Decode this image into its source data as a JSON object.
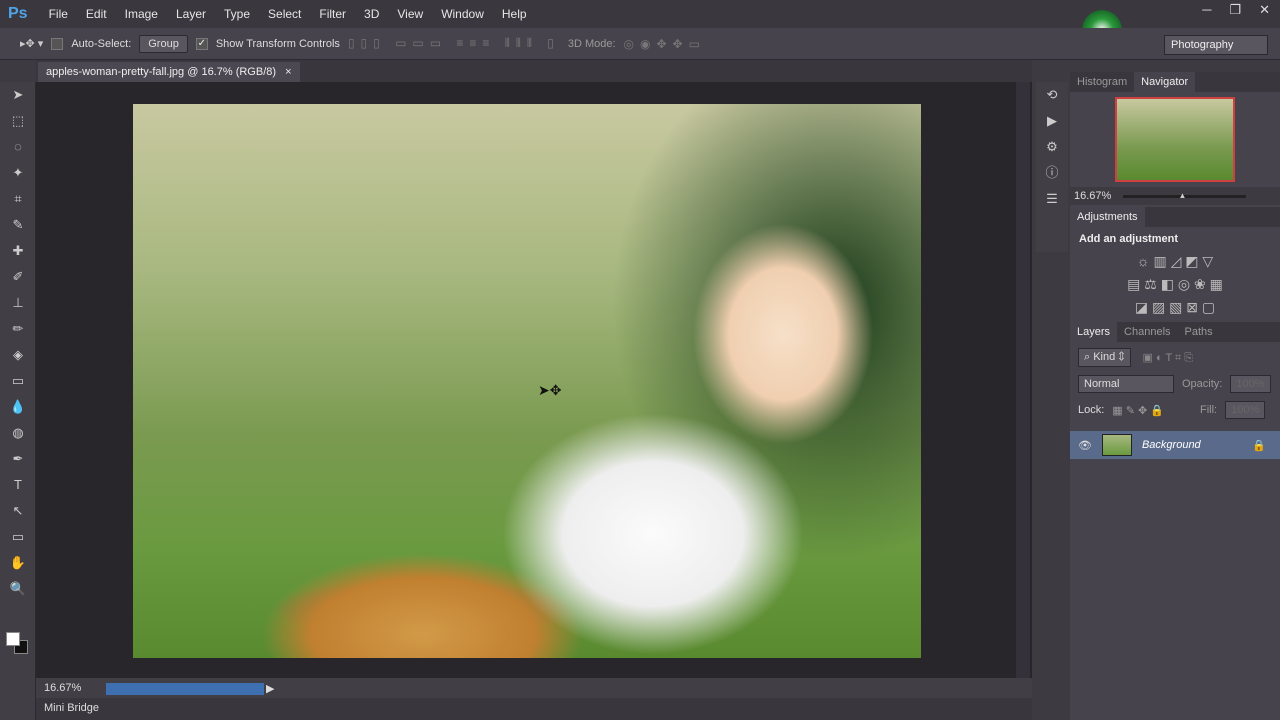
{
  "app": {
    "logo": "Ps"
  },
  "menu": [
    "File",
    "Edit",
    "Image",
    "Layer",
    "Type",
    "Select",
    "Filter",
    "3D",
    "View",
    "Window",
    "Help"
  ],
  "window_controls": [
    "─",
    "❐",
    "✕"
  ],
  "options": {
    "auto_select": "Auto-Select:",
    "group": "Group",
    "show_transform": "Show Transform Controls",
    "mode_3d": "3D Mode:",
    "workspace": "Photography"
  },
  "document": {
    "tab": "apples-woman-pretty-fall.jpg @ 16.7% (RGB/8)",
    "close": "×",
    "zoom": "16.67%"
  },
  "bottom": {
    "mini_bridge": "Mini Bridge"
  },
  "navigator": {
    "tabs": [
      "Histogram",
      "Navigator"
    ],
    "zoom": "16.67%",
    "slider_fraction": 0.45
  },
  "adjustments": {
    "tab": "Adjustments",
    "title": "Add an adjustment"
  },
  "layers": {
    "tabs": [
      "Layers",
      "Channels",
      "Paths"
    ],
    "kind": "Kind",
    "blend": "Normal",
    "opacity_label": "Opacity:",
    "opacity": "100%",
    "lock_label": "Lock:",
    "fill_label": "Fill:",
    "fill": "100%",
    "layer_name": "Background"
  },
  "tools": [
    "➤",
    "⬚",
    "◌",
    "✦",
    "⌗",
    "✎",
    "✚",
    "✐",
    "⊥",
    "✏",
    "◈",
    "▭",
    "💧",
    "◍",
    "✒",
    "T",
    "↖",
    "▭",
    "✋",
    "🔍"
  ]
}
